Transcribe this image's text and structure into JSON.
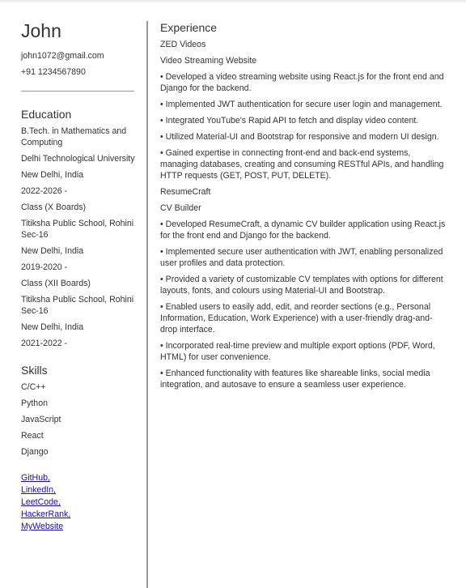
{
  "person": {
    "name": "John",
    "email": "john1072@gmail.com",
    "phone": "+91 1234567890"
  },
  "education": {
    "heading": "Education",
    "lines": [
      "B.Tech. in Mathematics and Computing",
      "Delhi Technological University",
      "New Delhi, India",
      "2022-2026 -",
      "Class (X Boards)",
      "Titiksha Public School, Rohini Sec-16",
      "New Delhi, India",
      "2019-2020 -",
      "Class (XII Boards)",
      "Titiksha Public School, Rohini Sec-16",
      "New Delhi, India",
      "2021-2022 -"
    ]
  },
  "skills": {
    "heading": "Skills",
    "items": [
      "C/C++",
      "Python",
      "JavaScript",
      "React",
      "Django"
    ]
  },
  "links": [
    "GitHub,",
    "LinkedIn,",
    "LeetCode,",
    "HackerRank,",
    "MyWebsite"
  ],
  "experience": {
    "heading": "Experience",
    "jobs": [
      {
        "company": "ZED Videos",
        "title": "Video Streaming Website",
        "bullets": [
          "• Developed a video streaming website using React.js for the front end and Django for the backend.",
          "• Implemented JWT authentication for secure user login and management.",
          "• Integrated YouTube's Rapid API to fetch and display video content.",
          "• Utilized Material-UI and Bootstrap for responsive and modern UI design.",
          "• Gained expertise in connecting front-end and back-end systems, managing databases, creating and consuming RESTful APIs, and handling HTTP requests (GET, POST, PUT, DELETE)."
        ]
      },
      {
        "company": "ResumeCraft",
        "title": "CV Builder",
        "bullets": [
          "• Developed ResumeCraft, a dynamic CV builder application using React.js for the front end and Django for the backend.",
          "• Implemented secure user authentication with JWT, enabling personalized user profiles and data protection.",
          "• Provided a variety of customizable CV templates with options for different layouts, fonts, and colours using Material-UI and Bootstrap.",
          "• Enabled users to easily add, edit, and reorder sections (e.g., Personal Information, Education, Work Experience) with a user-friendly drag-and-drop interface.",
          "• Incorporated real-time preview and multiple export options (PDF, Word, HTML) for user convenience.",
          "• Enhanced functionality with features like shareable links, social media integration, and autosave to ensure a seamless user experience."
        ]
      }
    ]
  }
}
